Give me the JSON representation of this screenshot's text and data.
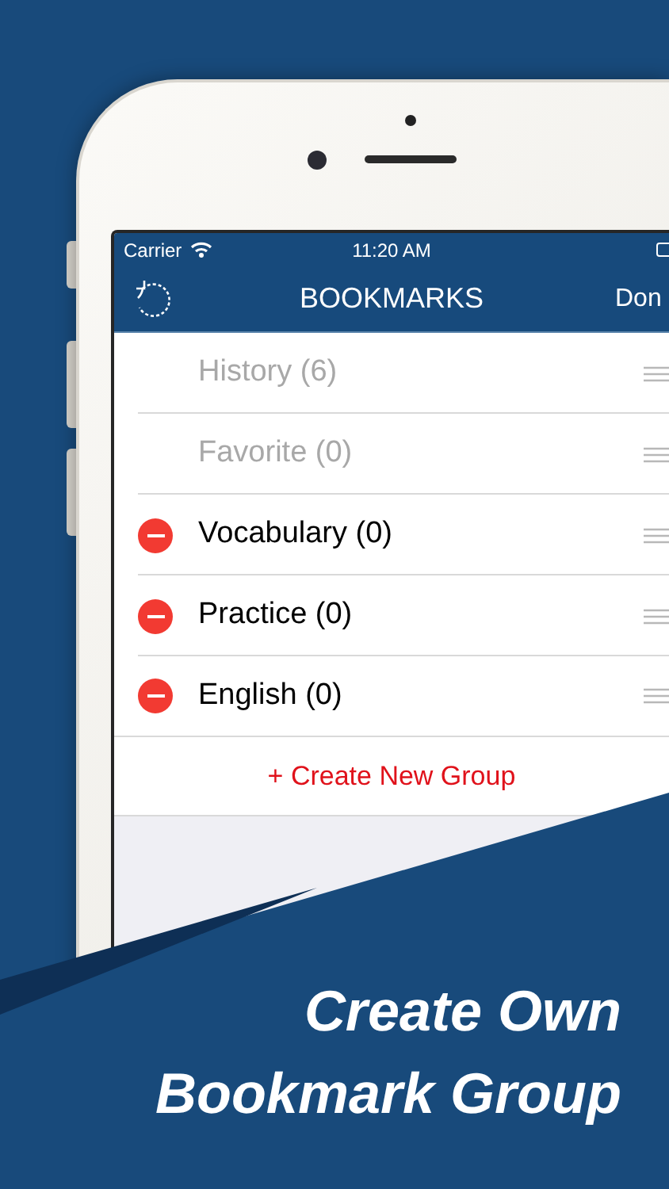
{
  "status_bar": {
    "carrier": "Carrier",
    "time": "11:20 AM"
  },
  "nav_bar": {
    "title": "BOOKMARKS",
    "right_button": "Don"
  },
  "groups": [
    {
      "label": "History (6)",
      "deletable": false
    },
    {
      "label": "Favorite (0)",
      "deletable": false
    },
    {
      "label": "Vocabulary (0)",
      "deletable": true
    },
    {
      "label": "Practice (0)",
      "deletable": true
    },
    {
      "label": "English (0)",
      "deletable": true
    }
  ],
  "create_button": {
    "label": "+ Create New Group"
  },
  "caption_lines": [
    "Create Own",
    "Bookmark Group"
  ]
}
